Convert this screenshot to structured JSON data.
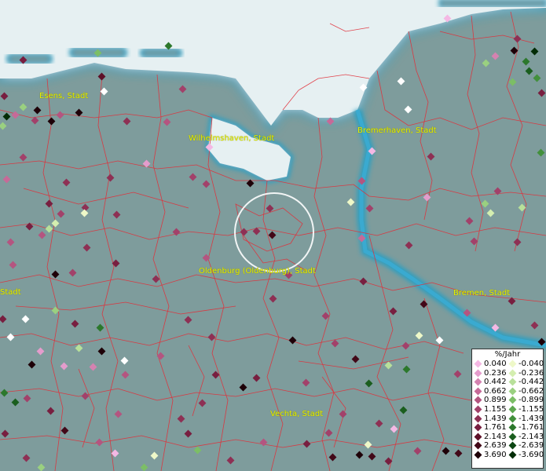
{
  "map": {
    "cities": [
      {
        "label": "Esens, Stadt",
        "id": "esens"
      },
      {
        "label": "Wilhelmshaven, Stadt",
        "id": "wilhelmshaven"
      },
      {
        "label": "Bremerhaven, Stadt",
        "id": "bremerhaven"
      },
      {
        "label": "Oldenburg (Oldenburg), Stadt",
        "id": "oldenburg"
      },
      {
        "label": "Stadt",
        "id": "west-edge"
      },
      {
        "label": "Bremen, Stadt",
        "id": "bremen"
      },
      {
        "label": "Vechta, Stadt",
        "id": "vechta"
      }
    ],
    "colors": {
      "land": "#7e9c9c",
      "sea": "#e6f0f2",
      "coast": "#2f9fc0",
      "boundary": "#e0303a",
      "city_label": "#e8f000",
      "focus_ring": "#ffffff"
    },
    "legend": {
      "title": "%/Jahr",
      "positive": [
        "0.040",
        "0.236",
        "0.442",
        "0.662",
        "0.899",
        "1.155",
        "1.439",
        "1.761",
        "2.143",
        "2.639",
        "3.690"
      ],
      "negative": [
        "-0.040",
        "-0.236",
        "-0.442",
        "-0.662",
        "-0.899",
        "-1.155",
        "-1.439",
        "-1.761",
        "-2.143",
        "-2.639",
        "-3.690"
      ],
      "positive_colors": [
        "#f4b8e4",
        "#e49ccc",
        "#d482b0",
        "#c66a98",
        "#b45580",
        "#a2416a",
        "#8e3054",
        "#781f40",
        "#5e1028",
        "#420818",
        "#1e0008"
      ],
      "negative_colors": [
        "#eef8c8",
        "#d4eeb0",
        "#b8e09a",
        "#9ad080",
        "#7cbe66",
        "#5ea850",
        "#42903c",
        "#2c782c",
        "#1a5e1e",
        "#0c4612",
        "#022c06"
      ]
    }
  }
}
